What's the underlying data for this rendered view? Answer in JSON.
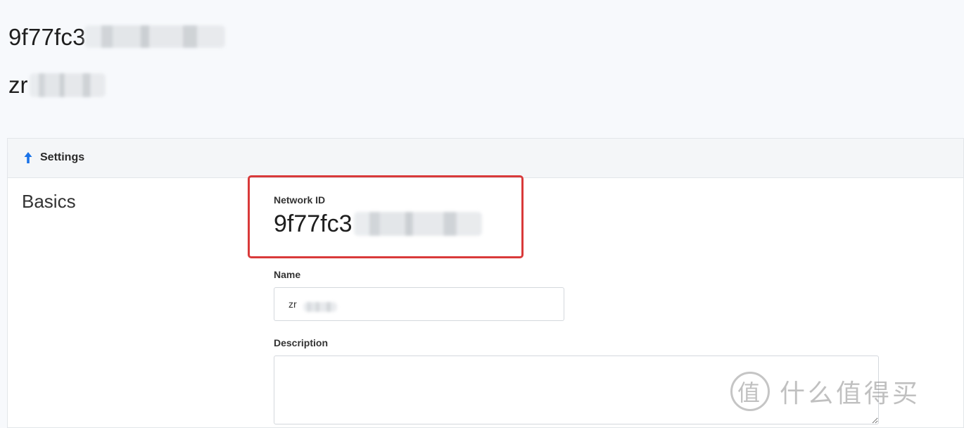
{
  "header": {
    "network_id": "9f77fc3",
    "network_name": "zr"
  },
  "settings": {
    "toggle_label": "Settings",
    "section_title": "Basics",
    "network_id_label": "Network ID",
    "network_id_value": "9f77fc3",
    "name_label": "Name",
    "name_value": "zr",
    "description_label": "Description",
    "description_value": ""
  },
  "watermark": {
    "logo_char": "值",
    "text": "什么值得买"
  },
  "colors": {
    "highlight": "#d93a3a",
    "accent_arrow": "#1a73e8"
  }
}
